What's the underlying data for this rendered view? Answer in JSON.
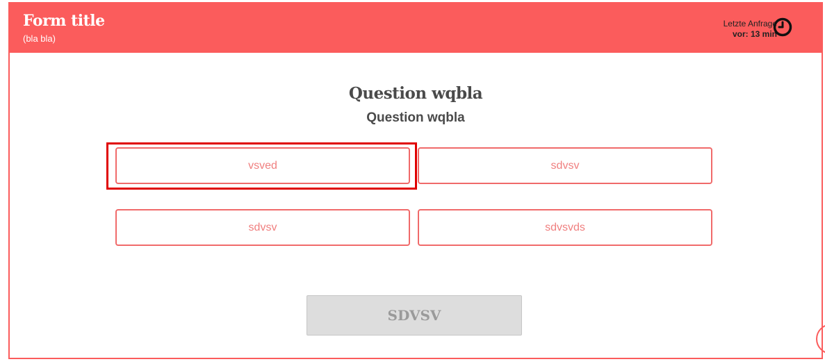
{
  "header": {
    "title": "Form title",
    "subtitle": "(bla bla)",
    "last_request_line1": "Letzte Anfrage",
    "last_request_line2": "vor: 13 min",
    "clock_icon": "clock-icon"
  },
  "question": {
    "title": "Question wqbla",
    "subtitle": "Question wqbla"
  },
  "options": [
    {
      "label": "vsved",
      "selected": true
    },
    {
      "label": "sdvsv",
      "selected": false
    },
    {
      "label": "sdvsv",
      "selected": false
    },
    {
      "label": "sdvsvds",
      "selected": false
    }
  ],
  "submit": {
    "label": "SDVSV",
    "enabled": false
  },
  "colors": {
    "accent": "#fb5c5c",
    "option_text": "#f07f7f",
    "highlight": "#e00000",
    "disabled_button": "#dddddd"
  }
}
